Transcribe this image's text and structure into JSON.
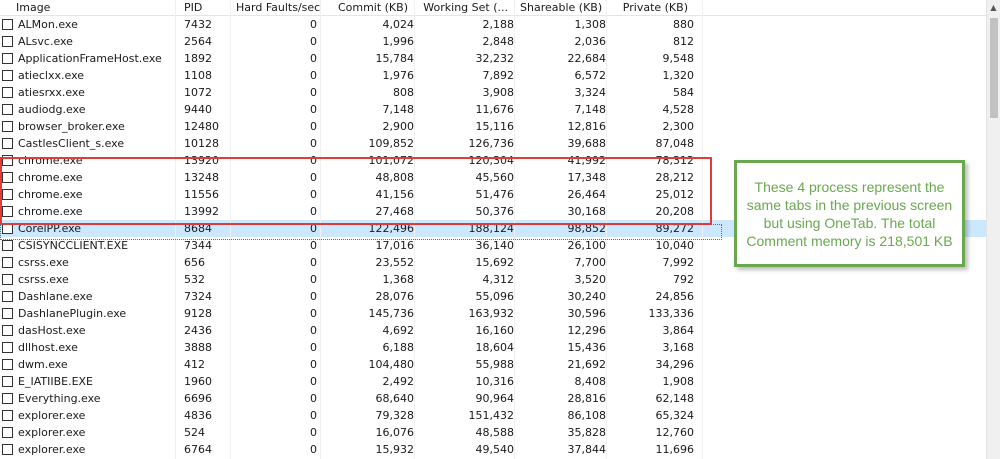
{
  "columns": {
    "image": "Image",
    "pid": "PID",
    "hard_faults": "Hard Faults/sec",
    "commit": "Commit (KB)",
    "working_set": "Working Set (...",
    "shareable": "Shareable (KB)",
    "private": "Private (KB)"
  },
  "rows": [
    {
      "image": "ALMon.exe",
      "pid": "7432",
      "hard_faults": "0",
      "commit": "4,024",
      "working_set": "2,188",
      "shareable": "1,308",
      "private": "880"
    },
    {
      "image": "ALsvc.exe",
      "pid": "2564",
      "hard_faults": "0",
      "commit": "1,996",
      "working_set": "2,848",
      "shareable": "2,036",
      "private": "812"
    },
    {
      "image": "ApplicationFrameHost.exe",
      "pid": "1892",
      "hard_faults": "0",
      "commit": "15,784",
      "working_set": "32,232",
      "shareable": "22,684",
      "private": "9,548"
    },
    {
      "image": "atieclxx.exe",
      "pid": "1108",
      "hard_faults": "0",
      "commit": "1,976",
      "working_set": "7,892",
      "shareable": "6,572",
      "private": "1,320"
    },
    {
      "image": "atiesrxx.exe",
      "pid": "1072",
      "hard_faults": "0",
      "commit": "808",
      "working_set": "3,908",
      "shareable": "3,324",
      "private": "584"
    },
    {
      "image": "audiodg.exe",
      "pid": "9440",
      "hard_faults": "0",
      "commit": "7,148",
      "working_set": "11,676",
      "shareable": "7,148",
      "private": "4,528"
    },
    {
      "image": "browser_broker.exe",
      "pid": "12480",
      "hard_faults": "0",
      "commit": "2,900",
      "working_set": "15,116",
      "shareable": "12,816",
      "private": "2,300"
    },
    {
      "image": "CastlesClient_s.exe",
      "pid": "10128",
      "hard_faults": "0",
      "commit": "109,852",
      "working_set": "126,736",
      "shareable": "39,688",
      "private": "87,048"
    },
    {
      "image": "chrome.exe",
      "pid": "13920",
      "hard_faults": "0",
      "commit": "101,072",
      "working_set": "120,304",
      "shareable": "41,992",
      "private": "78,312"
    },
    {
      "image": "chrome.exe",
      "pid": "13248",
      "hard_faults": "0",
      "commit": "48,808",
      "working_set": "45,560",
      "shareable": "17,348",
      "private": "28,212"
    },
    {
      "image": "chrome.exe",
      "pid": "11556",
      "hard_faults": "0",
      "commit": "41,156",
      "working_set": "51,476",
      "shareable": "26,464",
      "private": "25,012"
    },
    {
      "image": "chrome.exe",
      "pid": "13992",
      "hard_faults": "0",
      "commit": "27,468",
      "working_set": "50,376",
      "shareable": "30,168",
      "private": "20,208"
    },
    {
      "image": "CorelPP.exe",
      "pid": "8684",
      "hard_faults": "0",
      "commit": "122,496",
      "working_set": "188,124",
      "shareable": "98,852",
      "private": "89,272",
      "selected": true
    },
    {
      "image": "CSISYNCCLIENT.EXE",
      "pid": "7344",
      "hard_faults": "0",
      "commit": "17,016",
      "working_set": "36,140",
      "shareable": "26,100",
      "private": "10,040"
    },
    {
      "image": "csrss.exe",
      "pid": "656",
      "hard_faults": "0",
      "commit": "23,552",
      "working_set": "15,692",
      "shareable": "7,700",
      "private": "7,992"
    },
    {
      "image": "csrss.exe",
      "pid": "532",
      "hard_faults": "0",
      "commit": "1,368",
      "working_set": "4,312",
      "shareable": "3,520",
      "private": "792"
    },
    {
      "image": "Dashlane.exe",
      "pid": "7324",
      "hard_faults": "0",
      "commit": "28,076",
      "working_set": "55,096",
      "shareable": "30,240",
      "private": "24,856"
    },
    {
      "image": "DashlanePlugin.exe",
      "pid": "9128",
      "hard_faults": "0",
      "commit": "145,736",
      "working_set": "163,932",
      "shareable": "30,596",
      "private": "133,336"
    },
    {
      "image": "dasHost.exe",
      "pid": "2436",
      "hard_faults": "0",
      "commit": "4,692",
      "working_set": "16,160",
      "shareable": "12,296",
      "private": "3,864"
    },
    {
      "image": "dllhost.exe",
      "pid": "3888",
      "hard_faults": "0",
      "commit": "6,188",
      "working_set": "18,604",
      "shareable": "15,436",
      "private": "3,168"
    },
    {
      "image": "dwm.exe",
      "pid": "412",
      "hard_faults": "0",
      "commit": "104,480",
      "working_set": "55,988",
      "shareable": "21,692",
      "private": "34,296"
    },
    {
      "image": "E_IATIIBE.EXE",
      "pid": "1960",
      "hard_faults": "0",
      "commit": "2,492",
      "working_set": "10,316",
      "shareable": "8,408",
      "private": "1,908"
    },
    {
      "image": "Everything.exe",
      "pid": "6696",
      "hard_faults": "0",
      "commit": "68,640",
      "working_set": "90,964",
      "shareable": "28,816",
      "private": "62,148"
    },
    {
      "image": "explorer.exe",
      "pid": "4836",
      "hard_faults": "0",
      "commit": "79,328",
      "working_set": "151,432",
      "shareable": "86,108",
      "private": "65,324"
    },
    {
      "image": "explorer.exe",
      "pid": "524",
      "hard_faults": "0",
      "commit": "16,076",
      "working_set": "48,588",
      "shareable": "35,828",
      "private": "12,760"
    },
    {
      "image": "explorer.exe",
      "pid": "6764",
      "hard_faults": "0",
      "commit": "15,932",
      "working_set": "49,540",
      "shareable": "37,844",
      "private": "11,696"
    }
  ],
  "annotation": {
    "text": "These 4 process represent the same tabs in the previous screen but using OneTab. The total Comment memory is 218,501 KB",
    "box_color": "#e03c3c",
    "callout_color": "#6aa84f"
  },
  "colors": {
    "selected_row": "#cce8ff"
  }
}
